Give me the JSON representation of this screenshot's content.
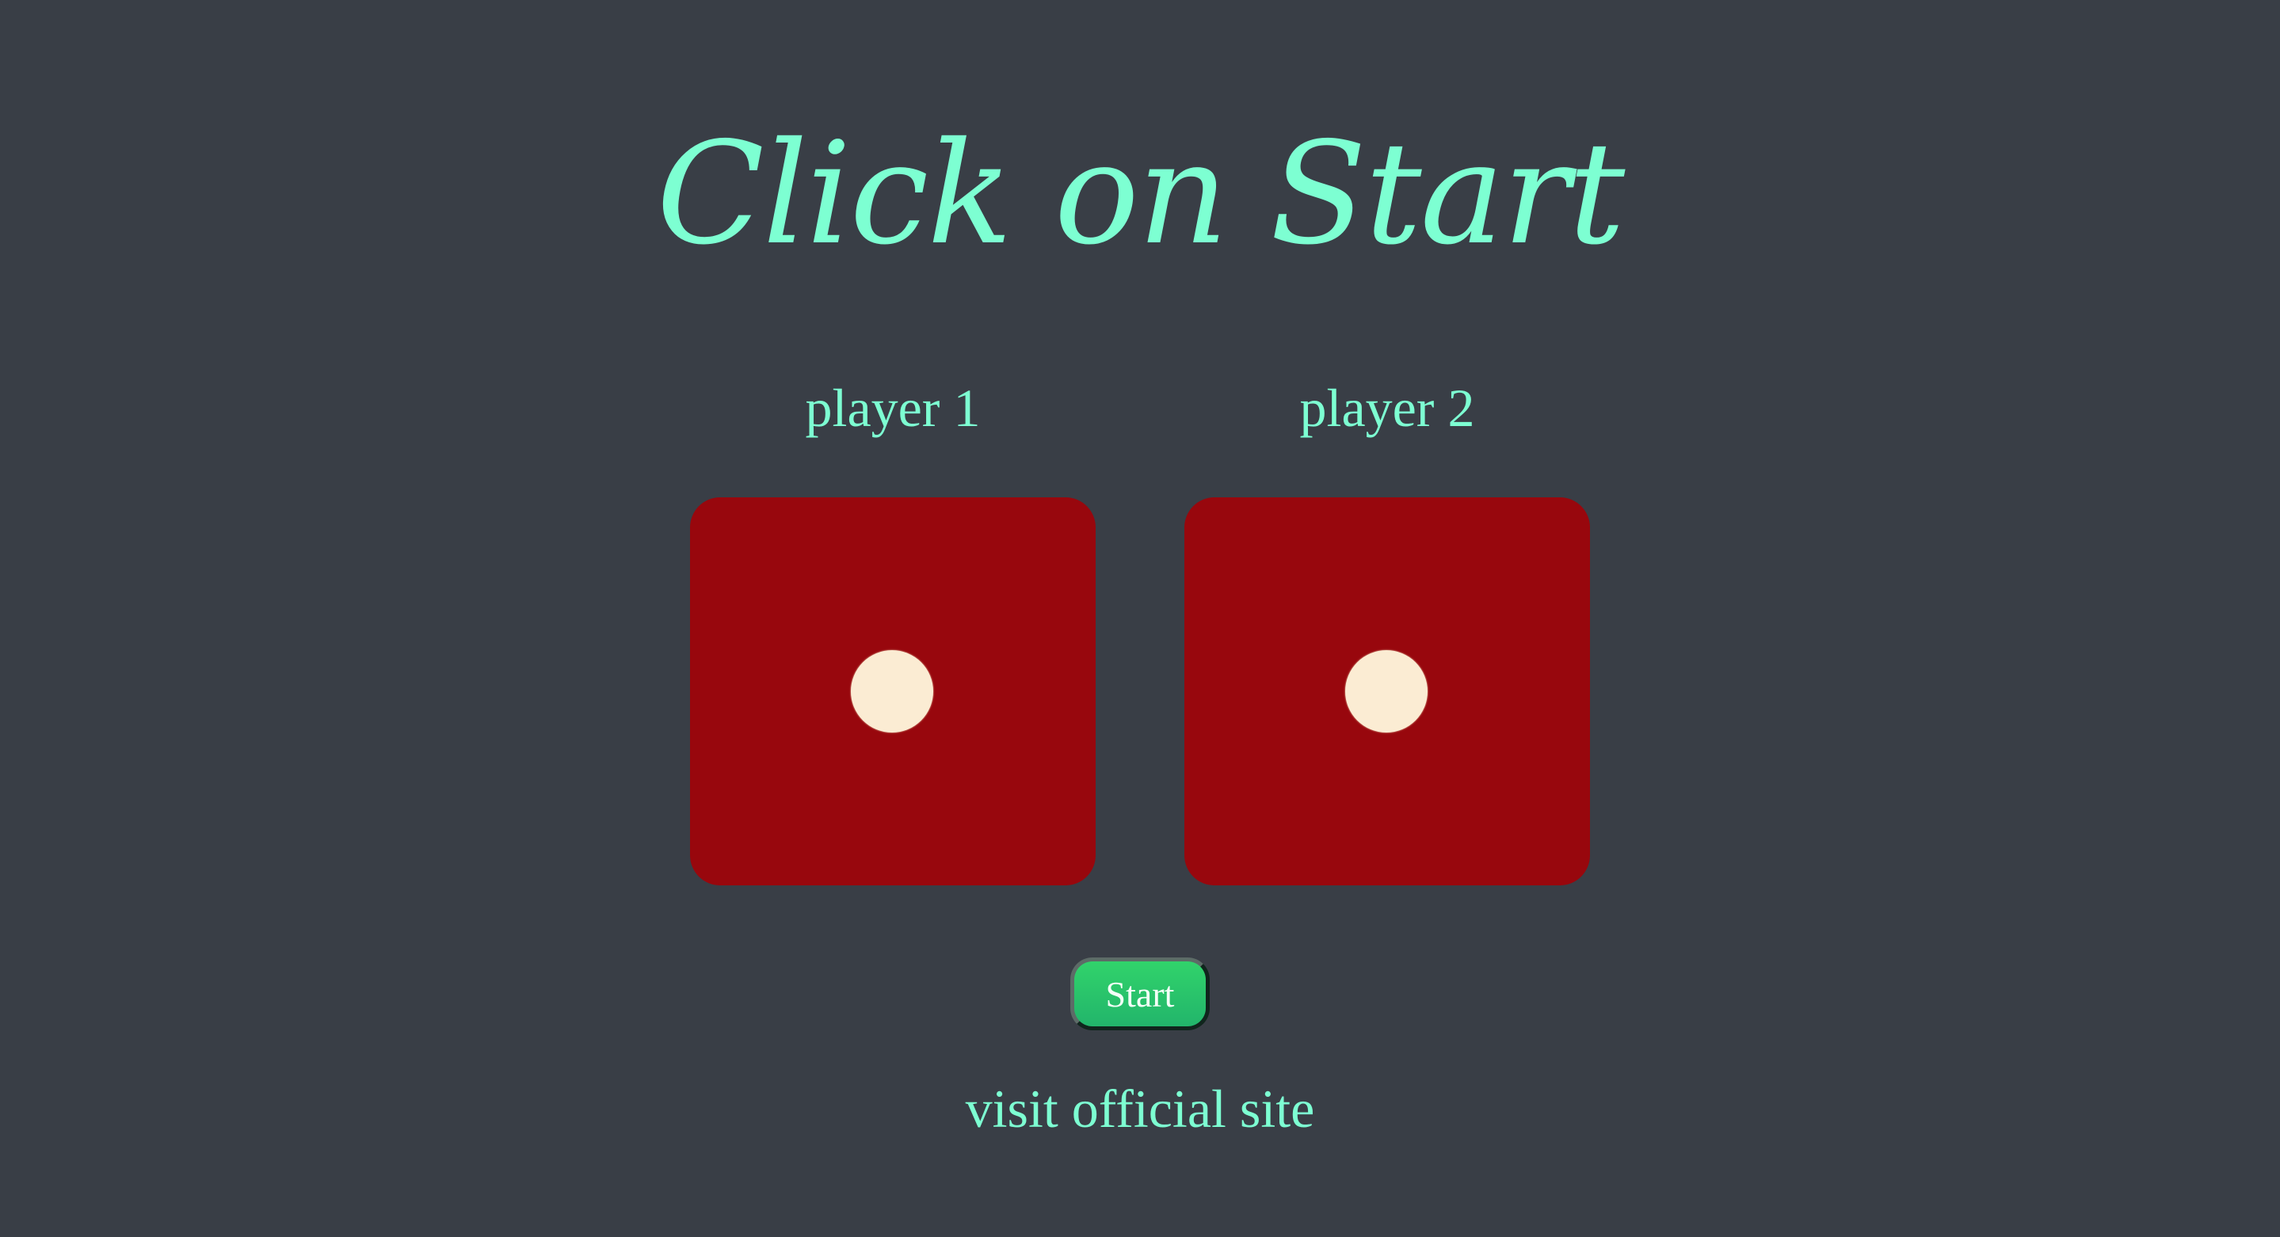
{
  "page": {
    "title": "Click on Start",
    "background_color": "#393e46",
    "accent_color": "#7dffd2"
  },
  "players": [
    {
      "label": "player 1",
      "die_value": 1
    },
    {
      "label": "player 2",
      "die_value": 1
    }
  ],
  "dice": {
    "face_color": "#98070d",
    "pip_color": "#fbecd3"
  },
  "controls": {
    "start_label": "Start",
    "link_text": "visit official site"
  }
}
